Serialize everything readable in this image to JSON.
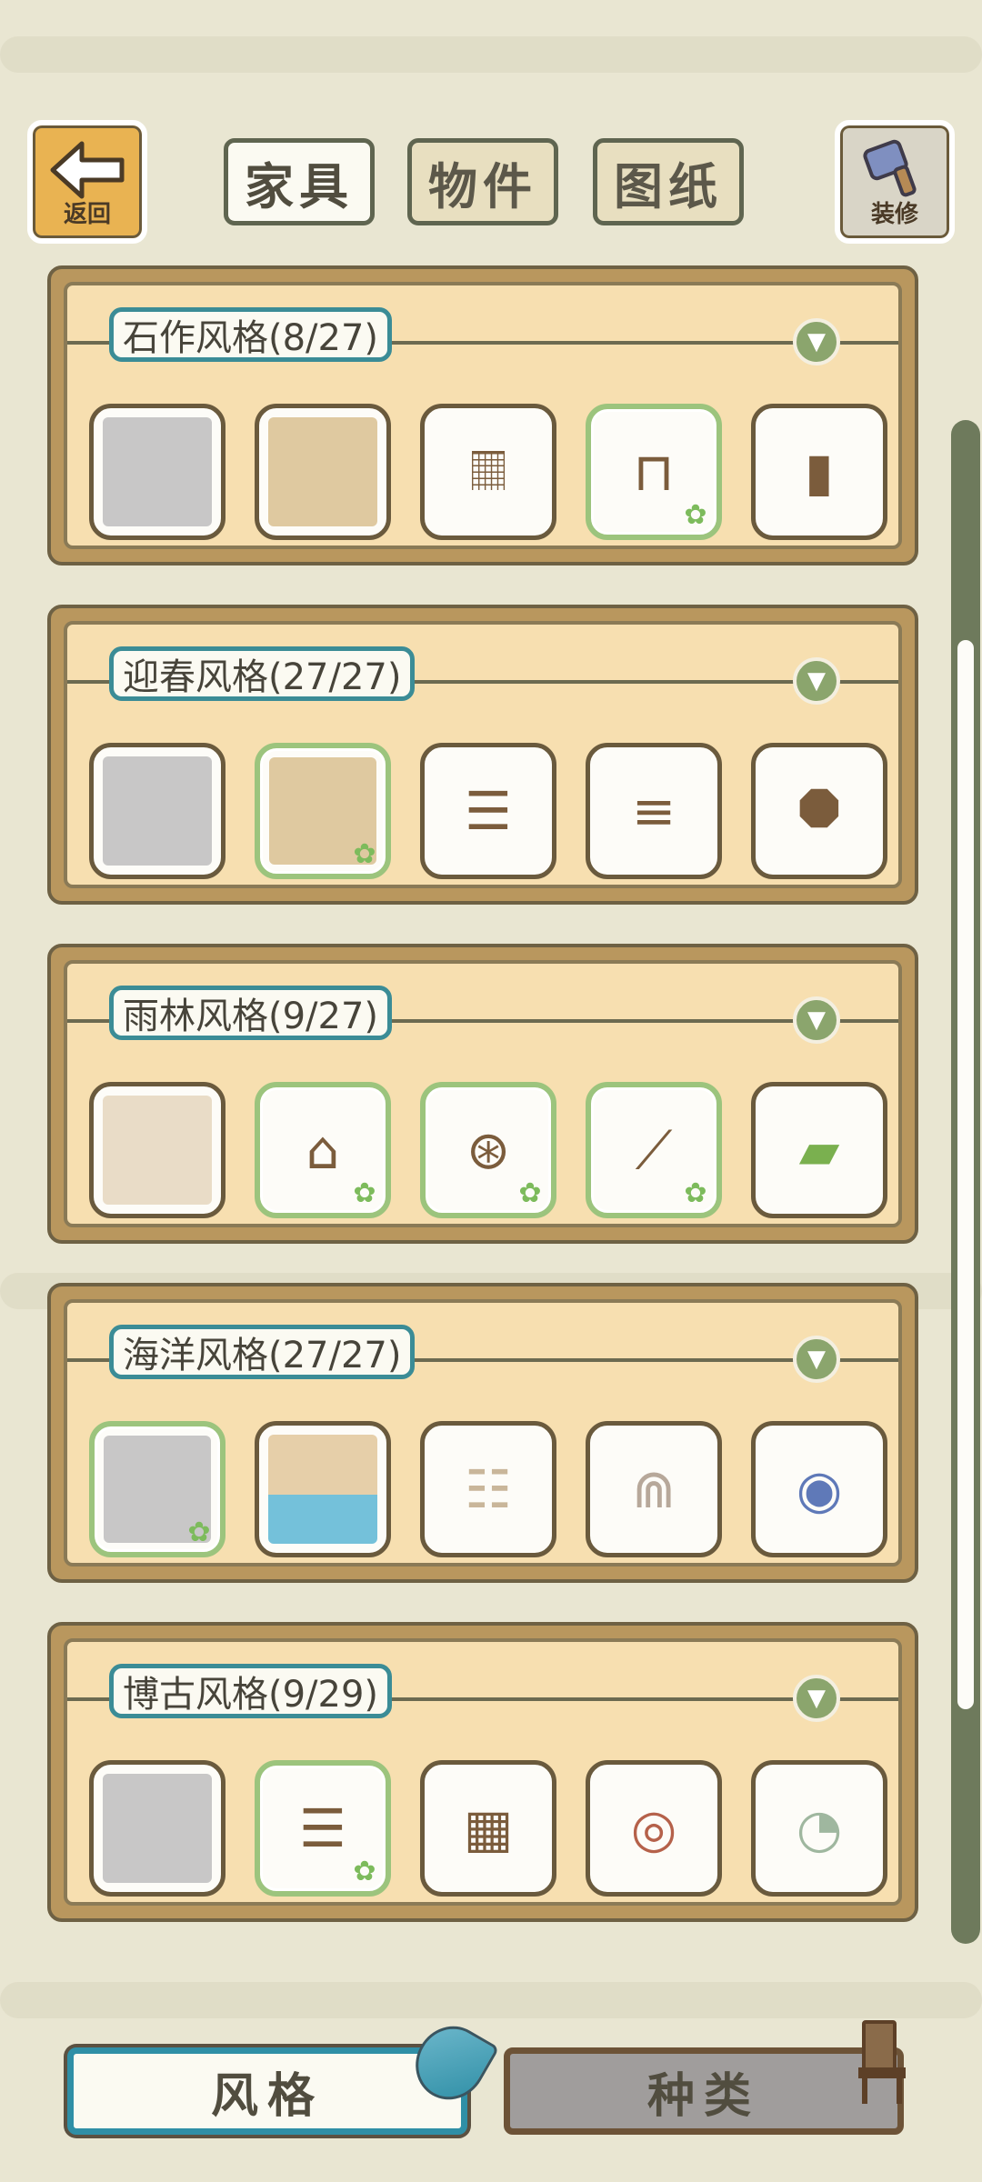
{
  "header": {
    "back_label": "返回",
    "decorate_label": "装修",
    "tabs": [
      {
        "label": "家具",
        "active": true
      },
      {
        "label": "物件",
        "active": false
      },
      {
        "label": "图纸",
        "active": false
      }
    ]
  },
  "styles": [
    {
      "title": "石作风格(8/27)",
      "items": [
        {
          "icon": "wall-icon",
          "owned": false
        },
        {
          "icon": "floor-icon",
          "owned": false
        },
        {
          "icon": "ladder-icon",
          "owned": false
        },
        {
          "icon": "table-icon",
          "owned": true
        },
        {
          "icon": "log-seat-icon",
          "owned": false
        }
      ]
    },
    {
      "title": "迎春风格(27/27)",
      "items": [
        {
          "icon": "wall-icon",
          "owned": false
        },
        {
          "icon": "floor-icon",
          "owned": true
        },
        {
          "icon": "ladder-icon",
          "owned": false
        },
        {
          "icon": "log-bench-icon",
          "owned": false
        },
        {
          "icon": "window-frame-icon",
          "owned": false
        }
      ]
    },
    {
      "title": "雨林风格(9/27)",
      "items": [
        {
          "icon": "wall-icon",
          "owned": false
        },
        {
          "icon": "vine-stool-icon",
          "owned": true
        },
        {
          "icon": "vine-ball-icon",
          "owned": true
        },
        {
          "icon": "bamboo-log-icon",
          "owned": true
        },
        {
          "icon": "bed-icon",
          "owned": false
        }
      ]
    },
    {
      "title": "海洋风格(27/27)",
      "items": [
        {
          "icon": "wall-icon",
          "owned": true
        },
        {
          "icon": "pool-floor-icon",
          "owned": false
        },
        {
          "icon": "bone-ladder-icon",
          "owned": false
        },
        {
          "icon": "coral-icon",
          "owned": false
        },
        {
          "icon": "porthole-icon",
          "owned": false
        }
      ]
    },
    {
      "title": "博古风格(9/29)",
      "items": [
        {
          "icon": "wall-icon",
          "owned": false
        },
        {
          "icon": "ladder-icon",
          "owned": true
        },
        {
          "icon": "lattice-door-icon",
          "owned": false
        },
        {
          "icon": "scroll-icon",
          "owned": false
        },
        {
          "icon": "jade-coins-icon",
          "owned": false
        }
      ]
    }
  ],
  "footer": {
    "style_tab_label": "风格",
    "category_tab_label": "种类"
  },
  "colors": {
    "accent_teal": "#2f8fa6",
    "owned_green": "#9cc47d",
    "panel_brown": "#b9975e",
    "panel_fill": "#f7dfb0"
  }
}
